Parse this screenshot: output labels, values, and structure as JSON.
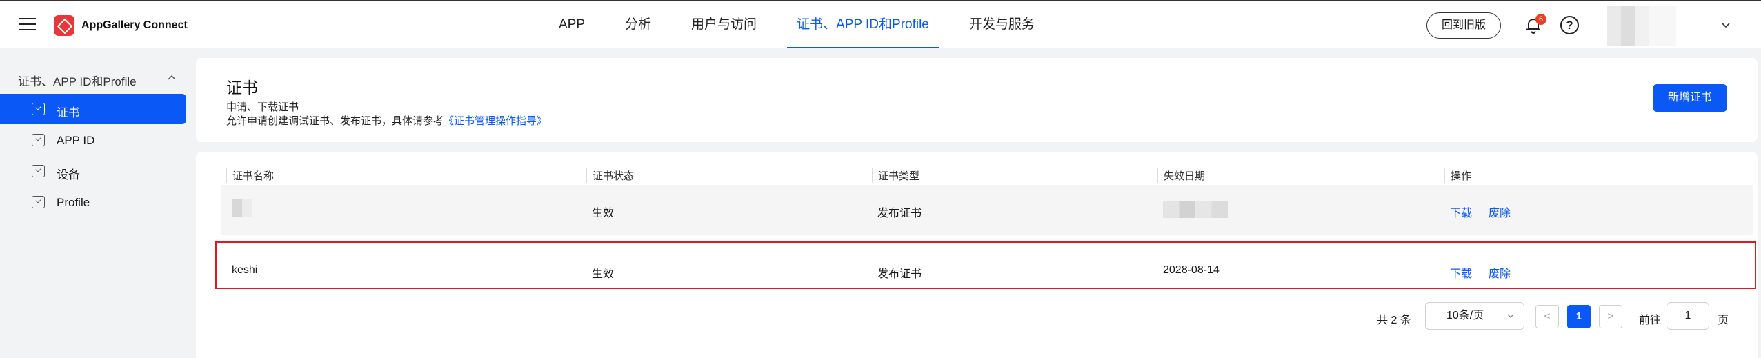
{
  "header": {
    "app_name": "AppGallery Connect",
    "nav": [
      {
        "label": "APP"
      },
      {
        "label": "分析"
      },
      {
        "label": "用户与访问"
      },
      {
        "label": "证书、APP ID和Profile"
      },
      {
        "label": "开发与服务"
      }
    ],
    "active_nav": "证书、APP ID和Profile",
    "old_version_label": "回到旧版",
    "notification_count": "6",
    "help_label": "?"
  },
  "sidebar": {
    "group_label": "证书、APP ID和Profile",
    "items": [
      {
        "label": "证书"
      },
      {
        "label": "APP ID"
      },
      {
        "label": "设备"
      },
      {
        "label": "Profile"
      }
    ],
    "active_item": "证书"
  },
  "page": {
    "title": "证书",
    "subtitle": "申请、下载证书",
    "desc_prefix": "允许申请创建调试证书、发布证书，具体请参考",
    "desc_link": "《证书管理操作指导》",
    "add_button": "新增证书"
  },
  "table": {
    "columns": [
      "证书名称",
      "证书状态",
      "证书类型",
      "失效日期",
      "操作"
    ],
    "rows": [
      {
        "name": "",
        "status": "生效",
        "type": "发布证书",
        "expiry": "",
        "action_download": "下载",
        "action_revoke": "废除"
      },
      {
        "name": "keshi",
        "status": "生效",
        "type": "发布证书",
        "expiry": "2028-08-14",
        "action_download": "下载",
        "action_revoke": "废除"
      }
    ]
  },
  "pagination": {
    "total_label": "共 2 条",
    "page_size": "10条/页",
    "prev": "<",
    "current_page": "1",
    "next": ">",
    "goto_label": "前往",
    "goto_value": "1",
    "page_suffix": "页"
  },
  "colors": {
    "accent": "#0a59f7",
    "highlight_border": "#e8141e",
    "badge": "#e84026",
    "brand_logo": "#e8373c"
  }
}
